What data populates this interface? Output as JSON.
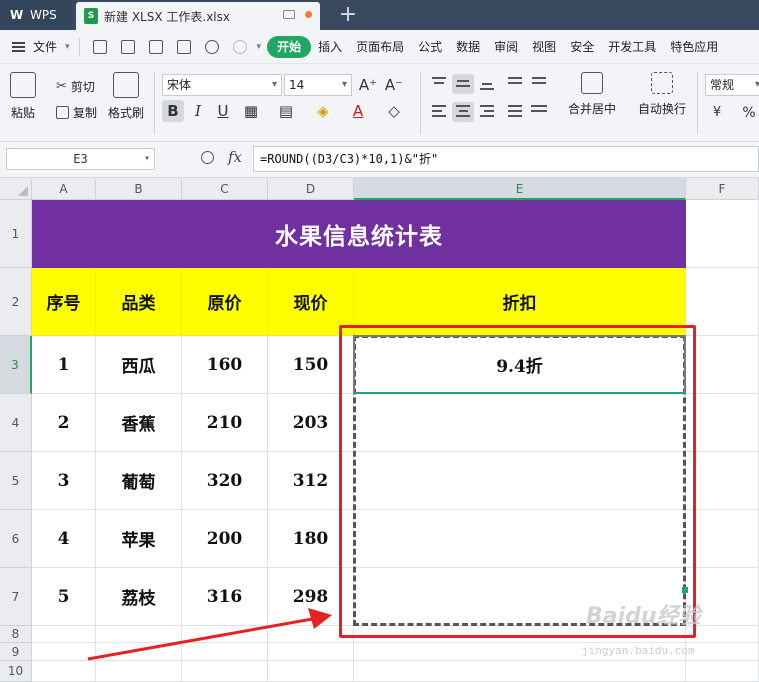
{
  "titlebar": {
    "app_name": "WPS",
    "doc_tab_title": "新建 XLSX 工作表.xlsx",
    "new_tab_symbol": "+"
  },
  "menubar": {
    "file_label": "文件",
    "items": [
      "开始",
      "插入",
      "页面布局",
      "公式",
      "数据",
      "审阅",
      "视图",
      "安全",
      "开发工具",
      "特色应用"
    ],
    "active_index": 0
  },
  "ribbon": {
    "paste_label": "粘贴",
    "cut_label": "剪切",
    "copy_label": "复制",
    "format_painter_label": "格式刷",
    "font_name": "宋体",
    "font_size": "14",
    "bold": "B",
    "italic": "I",
    "underline": "U",
    "merge_center_label": "合并居中",
    "wrap_text_label": "自动换行",
    "number_format": "常规",
    "percent_symbol": "%"
  },
  "formula_bar": {
    "cell_ref": "E3",
    "fx_label": "fx",
    "formula": "=ROUND((D3/C3)*10,1)&\"折\""
  },
  "sheet": {
    "columns": [
      "A",
      "B",
      "C",
      "D",
      "E",
      "F"
    ],
    "rows": [
      "1",
      "2",
      "3",
      "4",
      "5",
      "6",
      "7",
      "8",
      "9",
      "10"
    ],
    "title": "水果信息统计表",
    "headers": [
      "序号",
      "品类",
      "原价",
      "现价",
      "折扣"
    ],
    "data": [
      [
        "1",
        "西瓜",
        "160",
        "150",
        "9.4折"
      ],
      [
        "2",
        "香蕉",
        "210",
        "203",
        ""
      ],
      [
        "3",
        "葡萄",
        "320",
        "312",
        ""
      ],
      [
        "4",
        "苹果",
        "200",
        "180",
        ""
      ],
      [
        "5",
        "荔枝",
        "316",
        "298",
        ""
      ]
    ],
    "selected_cell": "E3",
    "colors": {
      "title_bg": "#7030a0",
      "title_fg": "#ffffff",
      "header_bg": "#ffff00",
      "selection_green": "#21a663",
      "annotation_red": "#e52222"
    }
  },
  "watermark": {
    "brand": "Baidu经验",
    "url": "jingyan.baidu.com"
  }
}
